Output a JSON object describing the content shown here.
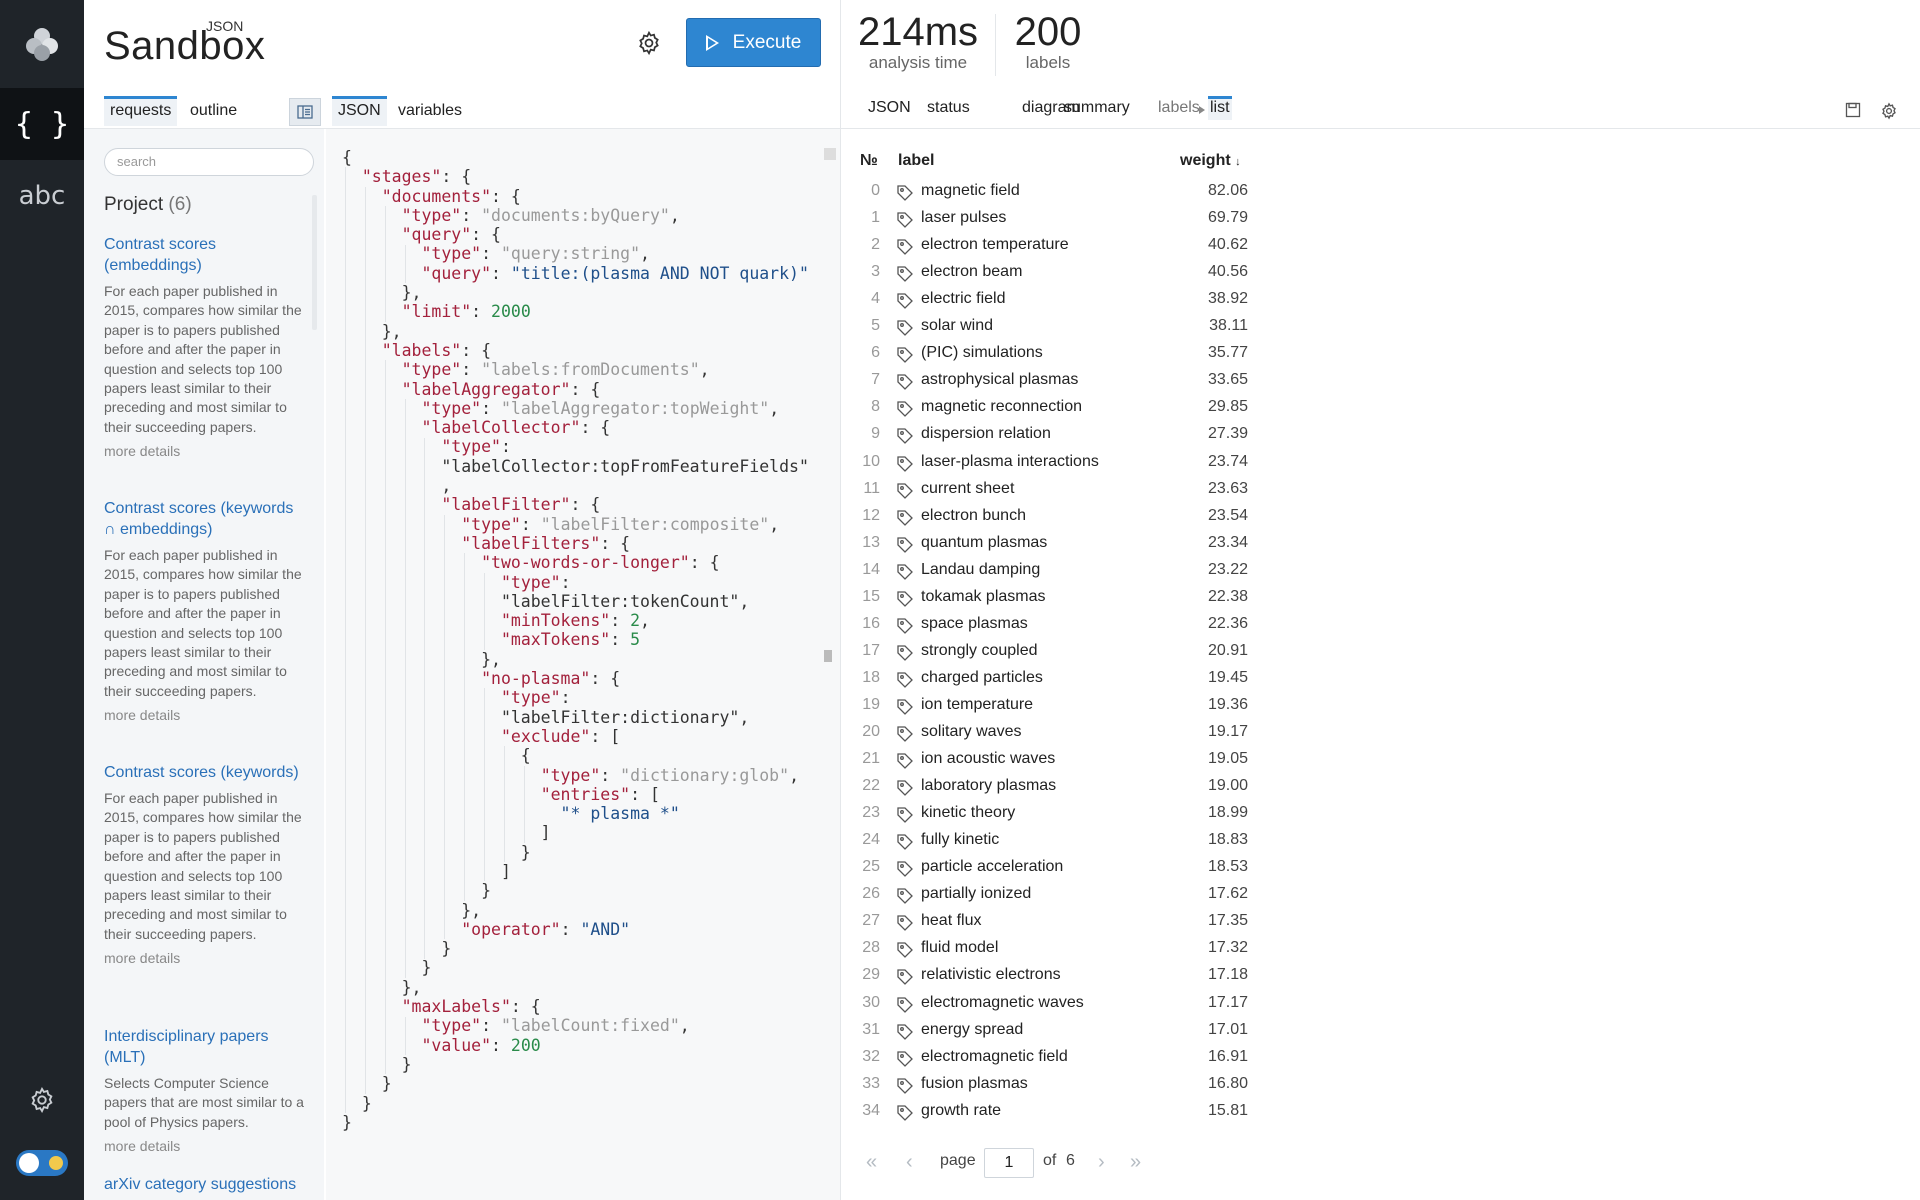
{
  "app": {
    "brand_small": "JSON",
    "brand_big": "Sandbox",
    "execute_label": "Execute"
  },
  "rail": {
    "json_mode": "{ }",
    "abc_mode": "abc"
  },
  "left_tabs": {
    "requests": "requests",
    "outline": "outline",
    "json": "JSON",
    "variables": "variables"
  },
  "search": {
    "placeholder": "search"
  },
  "project": {
    "title": "Project",
    "count": "(6)"
  },
  "requests": [
    {
      "title": "Contrast scores (embeddings)",
      "desc": "For each paper published in 2015, compares how similar the paper is to papers published before and after the paper in question and selects top 100 papers least similar to their preceding and most similar to their succeeding papers.",
      "more": "more details"
    },
    {
      "title": "Contrast scores (keywords ∩ embeddings)",
      "desc": "For each paper published in 2015, compares how similar the paper is to papers published before and after the paper in question and selects top 100 papers least similar to their preceding and most similar to their succeeding papers.",
      "more": "more details"
    },
    {
      "title": "Contrast scores (keywords)",
      "desc": "For each paper published in 2015, compares how similar the paper is to papers published before and after the paper in question and selects top 100 papers least similar to their preceding and most similar to their succeeding papers.",
      "more": "more details"
    },
    {
      "title": "Interdisciplinary papers (MLT)",
      "desc": "Selects Computer Science papers that are most similar to a pool of Physics papers.",
      "more": "more details"
    },
    {
      "title": "arXiv category suggestions",
      "desc": "",
      "more": ""
    }
  ],
  "stats": {
    "time_value": "214ms",
    "time_label": "analysis time",
    "labels_value": "200",
    "labels_label": "labels"
  },
  "right_tabs": {
    "json": "JSON",
    "status": "status",
    "diagram": "diagram",
    "summary": "summary",
    "labels": "labels",
    "list": "list"
  },
  "table": {
    "col_no": "№",
    "col_label": "label",
    "col_weight": "weight",
    "rows": [
      {
        "i": "0",
        "label": "magnetic field",
        "w": "82.06"
      },
      {
        "i": "1",
        "label": "laser pulses",
        "w": "69.79"
      },
      {
        "i": "2",
        "label": "electron temperature",
        "w": "40.62"
      },
      {
        "i": "3",
        "label": "electron beam",
        "w": "40.56"
      },
      {
        "i": "4",
        "label": "electric field",
        "w": "38.92"
      },
      {
        "i": "5",
        "label": "solar wind",
        "w": "38.11"
      },
      {
        "i": "6",
        "label": "(PIC) simulations",
        "w": "35.77"
      },
      {
        "i": "7",
        "label": "astrophysical plasmas",
        "w": "33.65"
      },
      {
        "i": "8",
        "label": "magnetic reconnection",
        "w": "29.85"
      },
      {
        "i": "9",
        "label": "dispersion relation",
        "w": "27.39"
      },
      {
        "i": "10",
        "label": "laser-plasma interactions",
        "w": "23.74"
      },
      {
        "i": "11",
        "label": "current sheet",
        "w": "23.63"
      },
      {
        "i": "12",
        "label": "electron bunch",
        "w": "23.54"
      },
      {
        "i": "13",
        "label": "quantum plasmas",
        "w": "23.34"
      },
      {
        "i": "14",
        "label": "Landau damping",
        "w": "23.22"
      },
      {
        "i": "15",
        "label": "tokamak plasmas",
        "w": "22.38"
      },
      {
        "i": "16",
        "label": "space plasmas",
        "w": "22.36"
      },
      {
        "i": "17",
        "label": "strongly coupled",
        "w": "20.91"
      },
      {
        "i": "18",
        "label": "charged particles",
        "w": "19.45"
      },
      {
        "i": "19",
        "label": "ion temperature",
        "w": "19.36"
      },
      {
        "i": "20",
        "label": "solitary waves",
        "w": "19.17"
      },
      {
        "i": "21",
        "label": "ion acoustic waves",
        "w": "19.05"
      },
      {
        "i": "22",
        "label": "laboratory plasmas",
        "w": "19.00"
      },
      {
        "i": "23",
        "label": "kinetic theory",
        "w": "18.99"
      },
      {
        "i": "24",
        "label": "fully kinetic",
        "w": "18.83"
      },
      {
        "i": "25",
        "label": "particle acceleration",
        "w": "18.53"
      },
      {
        "i": "26",
        "label": "partially ionized",
        "w": "17.62"
      },
      {
        "i": "27",
        "label": "heat flux",
        "w": "17.35"
      },
      {
        "i": "28",
        "label": "fluid model",
        "w": "17.32"
      },
      {
        "i": "29",
        "label": "relativistic electrons",
        "w": "17.18"
      },
      {
        "i": "30",
        "label": "electromagnetic waves",
        "w": "17.17"
      },
      {
        "i": "31",
        "label": "energy spread",
        "w": "17.01"
      },
      {
        "i": "32",
        "label": "electromagnetic field",
        "w": "16.91"
      },
      {
        "i": "33",
        "label": "fusion plasmas",
        "w": "16.80"
      },
      {
        "i": "34",
        "label": "growth rate",
        "w": "15.81"
      }
    ]
  },
  "pager": {
    "page_label": "page",
    "page_value": "1",
    "of_label": "of",
    "total": "6"
  },
  "code_lines": [
    "{",
    "  \"stages\": {",
    "    \"documents\": {",
    "      \"type\": \"documents:byQuery\",",
    "      \"query\": {",
    "        \"type\": \"query:string\",",
    "        \"query\": \"title:(plasma AND NOT quark)\"",
    "      },",
    "      \"limit\": 2000",
    "    },",
    "    \"labels\": {",
    "      \"type\": \"labels:fromDocuments\",",
    "      \"labelAggregator\": {",
    "        \"type\": \"labelAggregator:topWeight\",",
    "        \"labelCollector\": {",
    "          \"type\":",
    "          \"labelCollector:topFromFeatureFields\"",
    "          ,",
    "          \"labelFilter\": {",
    "            \"type\": \"labelFilter:composite\",",
    "            \"labelFilters\": {",
    "              \"two-words-or-longer\": {",
    "                \"type\":",
    "                \"labelFilter:tokenCount\",",
    "                \"minTokens\": 2,",
    "                \"maxTokens\": 5",
    "              },",
    "              \"no-plasma\": {",
    "                \"type\":",
    "                \"labelFilter:dictionary\",",
    "                \"exclude\": [",
    "                  {",
    "                    \"type\": \"dictionary:glob\",",
    "                    \"entries\": [",
    "                      \"* plasma *\"",
    "                    ]",
    "                  }",
    "                ]",
    "              }",
    "            },",
    "            \"operator\": \"AND\"",
    "          }",
    "        }",
    "      },",
    "      \"maxLabels\": {",
    "        \"type\": \"labelCount:fixed\",",
    "        \"value\": 200",
    "      }",
    "    }",
    "  }",
    "}"
  ]
}
